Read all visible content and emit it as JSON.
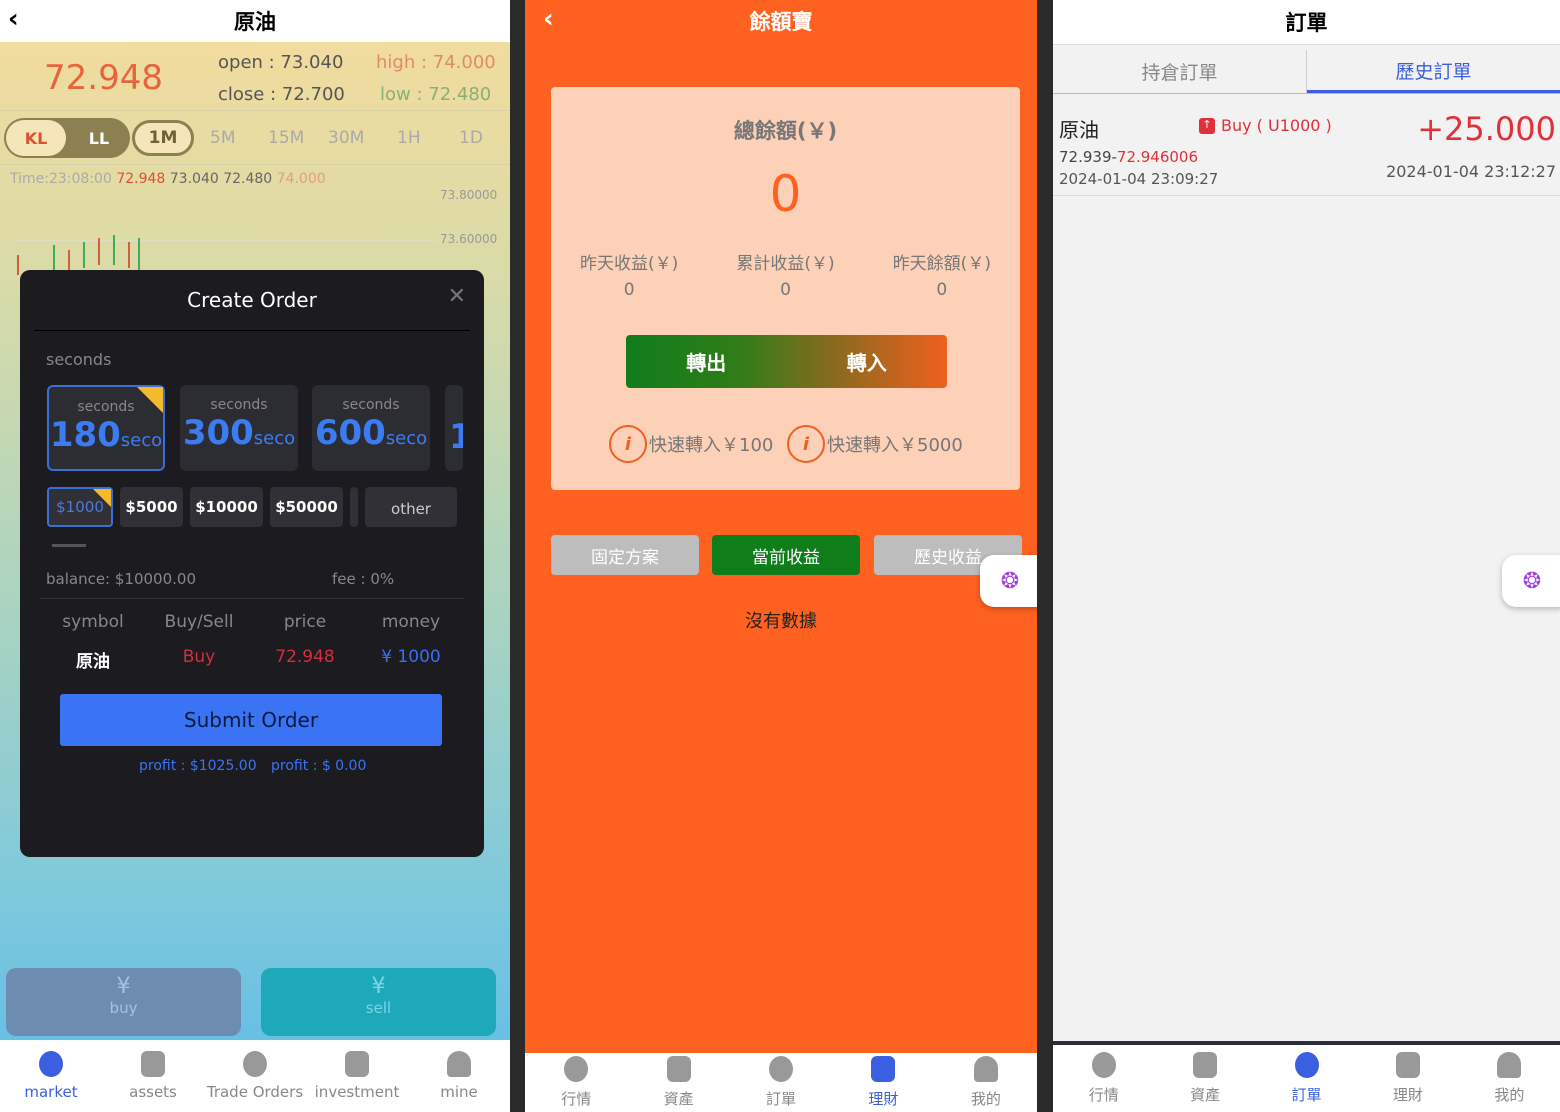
{
  "market": {
    "title": "原油",
    "price": "72.948",
    "open": "open : 73.040",
    "close": "close : 72.700",
    "high": "high : 74.000",
    "low": "low : 72.480",
    "chart_types": [
      "KL",
      "LL"
    ],
    "intervals": [
      "1M",
      "5M",
      "15M",
      "30M",
      "1H",
      "1D"
    ],
    "time_line": {
      "time": "Time:23:08:00",
      "v1": "72.948",
      "v2": "73.040",
      "v3": "72.480",
      "v4": "74.000"
    },
    "y_ticks": [
      "73.80000",
      "73.60000"
    ],
    "buy": "buy",
    "sell": "sell",
    "nav": [
      "market",
      "assets",
      "Trade Orders",
      "investment",
      "mine"
    ]
  },
  "order": {
    "title": "Create Order",
    "seconds_label": "seconds",
    "durations": [
      {
        "label": "seconds",
        "value": "180",
        "unit": "seco"
      },
      {
        "label": "seconds",
        "value": "300",
        "unit": "seco"
      },
      {
        "label": "seconds",
        "value": "600",
        "unit": "seco"
      },
      {
        "value": "1"
      }
    ],
    "amounts": [
      "$1000",
      "$5000",
      "$10000",
      "$50000"
    ],
    "other": "other",
    "balance": "balance: $10000.00",
    "fee": "fee : 0%",
    "headers": [
      "symbol",
      "Buy/Sell",
      "price",
      "money"
    ],
    "row": [
      "原油",
      "Buy",
      "72.948",
      "¥ 1000"
    ],
    "submit": "Submit Order",
    "profit1": "profit : $1025.00",
    "profit2": "profit : $ 0.00"
  },
  "yuebao": {
    "title": "餘額寶",
    "total_label": "總餘額(￥)",
    "total": "0",
    "stats": [
      {
        "label": "昨天收益(￥)",
        "value": "0"
      },
      {
        "label": "累計收益(￥)",
        "value": "0"
      },
      {
        "label": "昨天餘額(￥)",
        "value": "0"
      }
    ],
    "out": "轉出",
    "in": "轉入",
    "quick1": "快速轉入￥100",
    "quick2": "快速轉入￥5000",
    "tabs": [
      "固定方案",
      "當前收益",
      "歷史收益"
    ],
    "empty": "沒有數據",
    "nav": [
      "行情",
      "資產",
      "訂單",
      "理財",
      "我的"
    ]
  },
  "orders": {
    "title": "訂單",
    "tabs": [
      "持倉訂單",
      "歷史訂單"
    ],
    "item": {
      "symbol": "原油",
      "side": "Buy ( U1000 )",
      "range_start": "72.939-",
      "range_end": "72.946006",
      "open_time": "2024-01-04 23:09:27",
      "profit": "+25.000",
      "close_time": "2024-01-04 23:12:27"
    },
    "nav": [
      "行情",
      "資產",
      "訂單",
      "理財",
      "我的"
    ]
  },
  "colors": {
    "orange": "#ff6120",
    "blue": "#3a5fe0",
    "red": "#e0303a",
    "green": "#0f7d1a"
  }
}
